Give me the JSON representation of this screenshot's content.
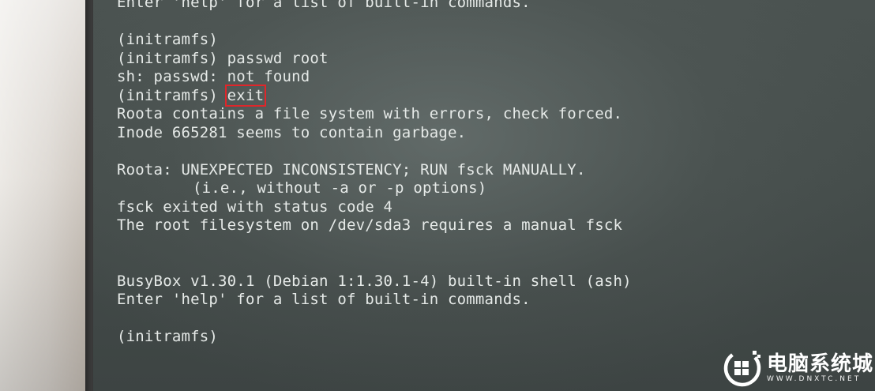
{
  "terminal": {
    "lines": [
      {
        "text": "Enter 'help' for a list of built-in commands."
      },
      {
        "text": ""
      },
      {
        "text": "(initramfs)"
      },
      {
        "text": "(initramfs) passwd root"
      },
      {
        "text": "sh: passwd: not found"
      },
      {
        "prompt": "(initramfs) ",
        "command": "exit"
      },
      {
        "text": "Roota contains a file system with errors, check forced."
      },
      {
        "text": "Inode 665281 seems to contain garbage."
      },
      {
        "text": ""
      },
      {
        "text": "Roota: UNEXPECTED INCONSISTENCY; RUN fsck MANUALLY."
      },
      {
        "text": "(i.e., without -a or -p options)"
      },
      {
        "text": "fsck exited with status code 4"
      },
      {
        "text": "The root filesystem on /dev/sda3 requires a manual fsck"
      },
      {
        "text": ""
      },
      {
        "text": ""
      },
      {
        "text": "BusyBox v1.30.1 (Debian 1:1.30.1-4) built-in shell (ash)"
      },
      {
        "text": "Enter 'help' for a list of built-in commands."
      },
      {
        "text": ""
      },
      {
        "text": "(initramfs)"
      }
    ]
  },
  "highlight_color": "#e0262a",
  "watermark": {
    "name": "电脑系统城",
    "url": "WWW.DNXTC.NET",
    "icon": "dnxtc-logo-icon"
  }
}
